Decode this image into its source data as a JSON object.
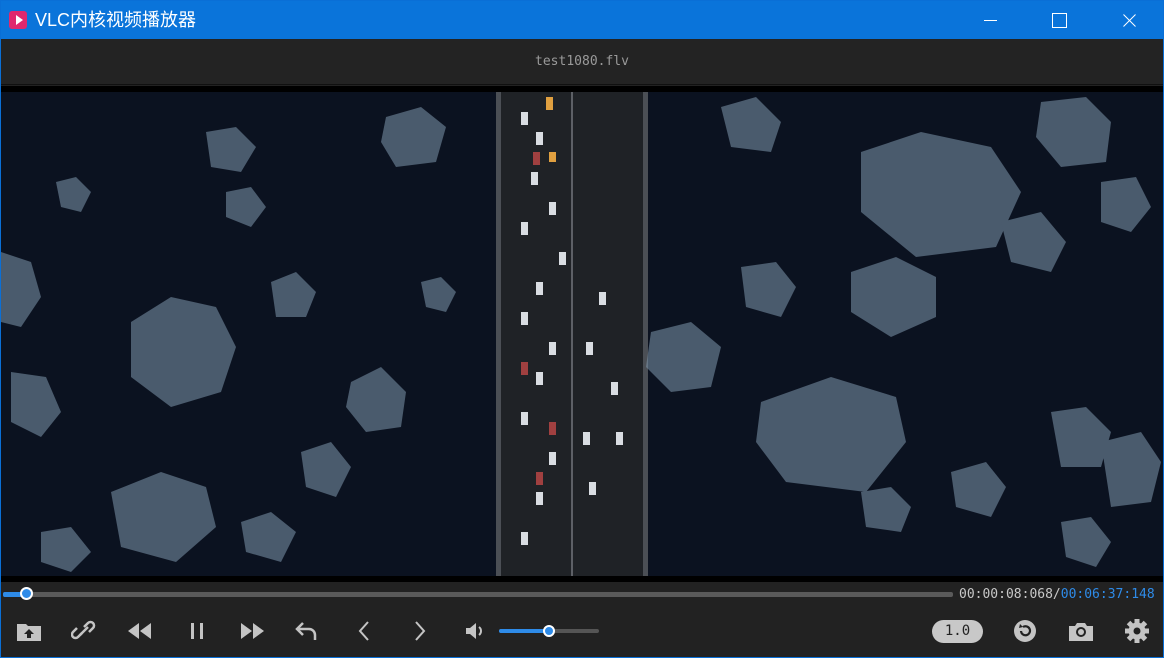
{
  "window": {
    "title": "VLC内核视频播放器",
    "icon": "vlc-app-icon"
  },
  "file": {
    "name": "test1080.flv"
  },
  "playback": {
    "current_time": "00:00:08:068",
    "separator": "/",
    "total_time": "00:06:37:148",
    "progress_fraction": 0.021,
    "volume_fraction": 0.5,
    "speed": "1.0"
  },
  "controls": {
    "icons": [
      "open-file-icon",
      "link-icon",
      "rewind-icon",
      "pause-icon",
      "fast-forward-icon",
      "undo-icon",
      "previous-icon",
      "next-icon",
      "volume-icon",
      "reload-icon",
      "camera-icon",
      "settings-icon"
    ]
  },
  "colors": {
    "accent": "#2e8be8",
    "titlebar": "#0a74da",
    "app_icon": "#e0286e"
  }
}
